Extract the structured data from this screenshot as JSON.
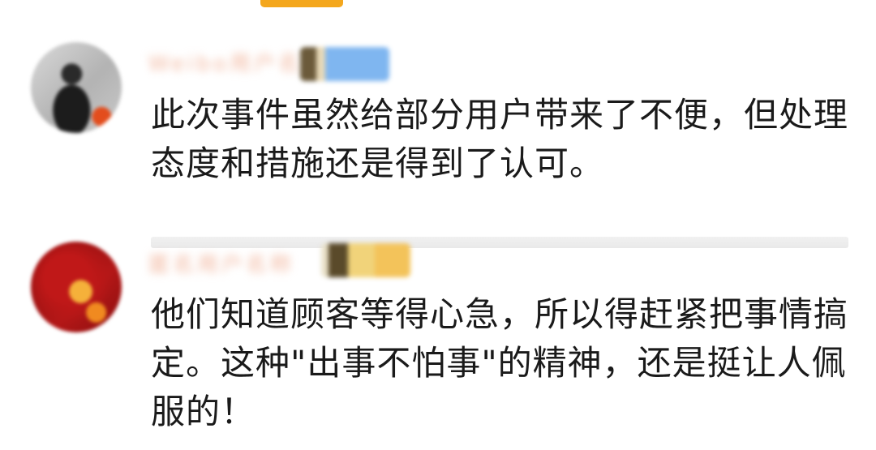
{
  "comments": [
    {
      "username": "Weibo用户名",
      "text": "此次事件虽然给部分用户带来了不便，但处理态度和措施还是得到了认可。"
    },
    {
      "username": "匿名用户名称",
      "text": "他们知道顾客等得心急，所以得赶紧把事情搞定。这种\"出事不怕事\"的精神，还是挺让人佩服的！"
    }
  ],
  "colors": {
    "tab_indicator": "#f4a71d",
    "text": "#1a1a1a",
    "divider": "#ececec"
  }
}
